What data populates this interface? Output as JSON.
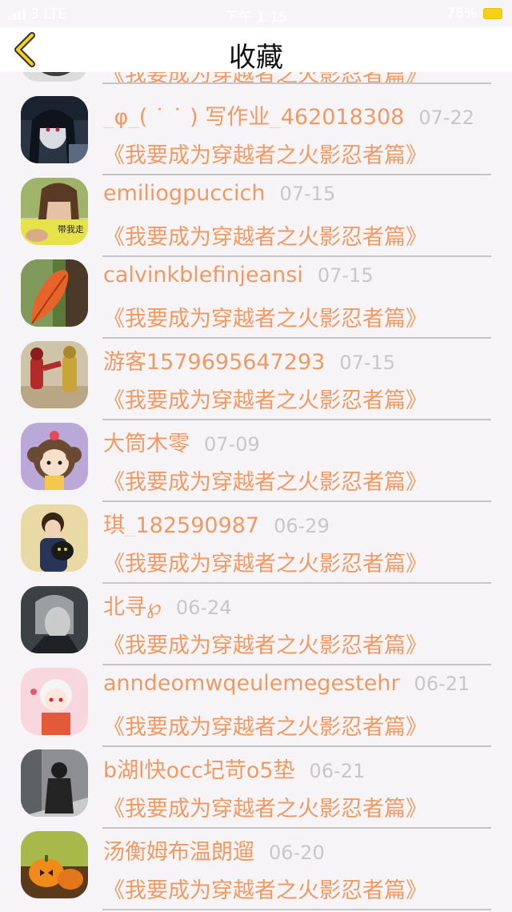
{
  "status_bar": {
    "carrier": "3",
    "network": "LTE",
    "time": "下午 1:15",
    "battery": "78%"
  },
  "header": {
    "title": "收藏"
  },
  "top_partial_row": {
    "title": "《我要成为穿越者之火影忍者篇》"
  },
  "items": [
    {
      "name": "_φ_( ˙ ˙ ) 写作业_462018308",
      "date": "07-22",
      "title": "《我要成为穿越者之火影忍者篇》",
      "avatar_icon": "anime-girl-avatar"
    },
    {
      "name": "emiliogpuccich",
      "date": "07-15",
      "title": "《我要成为穿越者之火影忍者篇》",
      "avatar_icon": "girl-photo-avatar",
      "avatar_caption": "带我走"
    },
    {
      "name": "calvinkblefinjeansi",
      "date": "07-15",
      "title": "《我要成为穿越者之火影忍者篇》",
      "avatar_icon": "autumn-leaf-avatar"
    },
    {
      "name": "游客1579695647293",
      "date": "07-15",
      "title": "《我要成为穿越者之火影忍者篇》",
      "avatar_icon": "kamen-rider-avatar"
    },
    {
      "name": "大筒木零",
      "date": "07-09",
      "title": "《我要成为穿越者之火影忍者篇》",
      "avatar_icon": "cartoon-girl-avatar"
    },
    {
      "name": "琪_182590987",
      "date": "06-29",
      "title": "《我要成为穿越者之火影忍者篇》",
      "avatar_icon": "anime-cat-girl-avatar"
    },
    {
      "name": "北寻℘",
      "date": "06-24",
      "title": "《我要成为穿越者之火影忍者篇》",
      "avatar_icon": "anime-boy-avatar"
    },
    {
      "name": "anndeomwqeulemegestehr",
      "date": "06-21",
      "title": "《我要成为穿越者之火影忍者篇》",
      "avatar_icon": "white-hair-anime-avatar"
    },
    {
      "name": "b湖l快occ圮苛o5垫",
      "date": "06-21",
      "title": "《我要成为穿越者之火影忍者篇》",
      "avatar_icon": "snow-person-avatar"
    },
    {
      "name": "汤衡姆布温朗遛",
      "date": "06-20",
      "title": "《我要成为穿越者之火影忍者篇》",
      "avatar_icon": "pumpkin-avatar"
    }
  ]
}
